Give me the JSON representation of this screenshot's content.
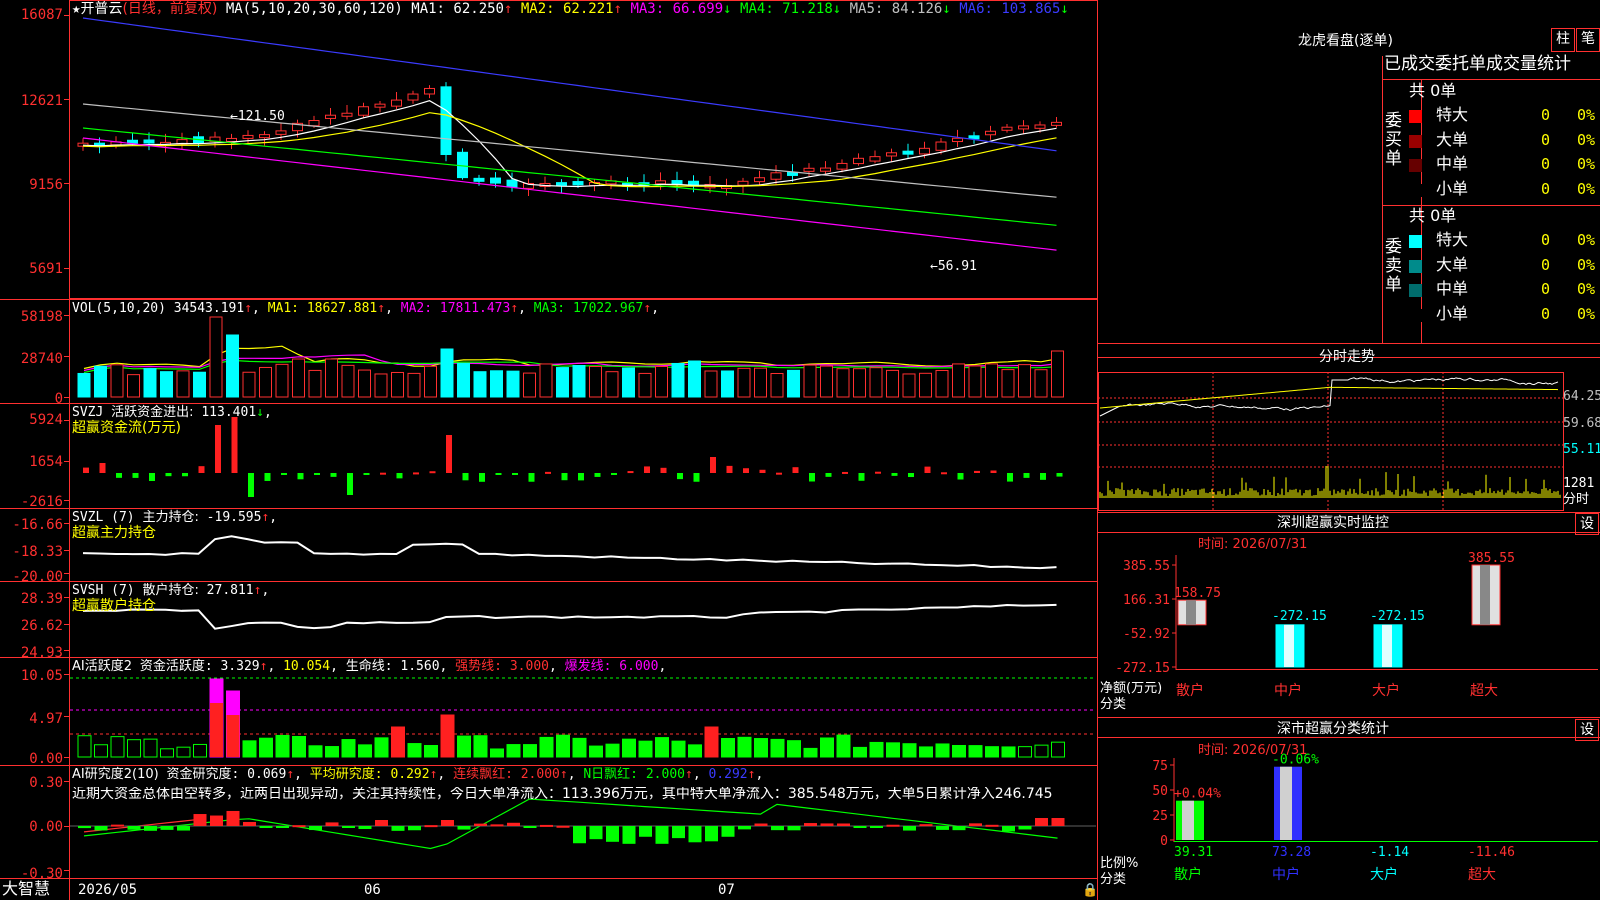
{
  "app": {
    "brand": "大智慧"
  },
  "main_chart": {
    "title_star": "★",
    "stock_name": "开普云",
    "mode": "(日线，前复权)",
    "ma_label": "MA(5,10,20,30,60,120)",
    "ma_values": [
      {
        "label": "MA1:",
        "value": "62.250",
        "arrow": "↑",
        "color": "#ffffff"
      },
      {
        "label": "MA2:",
        "value": "62.221",
        "arrow": "↑",
        "color": "#ffff00"
      },
      {
        "label": "MA3:",
        "value": "66.699",
        "arrow": "↓",
        "color": "#ff00ff"
      },
      {
        "label": "MA4:",
        "value": "71.218",
        "arrow": "↓",
        "color": "#00ff00"
      },
      {
        "label": "MA5:",
        "value": "84.126",
        "arrow": "↓",
        "color": "#c0c0c0"
      },
      {
        "label": "MA6:",
        "value": "103.865",
        "arrow": "↓",
        "color": "#3b3bff"
      }
    ],
    "y_ticks": [
      "16087",
      "12621",
      "9156",
      "5691"
    ],
    "annotation_high": "←121.50",
    "annotation_low": "←56.91"
  },
  "volume": {
    "label": "VOL(5,10,20)",
    "value": "34543.191",
    "arrow": "↑",
    "mas": [
      {
        "label": "MA1:",
        "value": "18627.881",
        "arrow": "↑",
        "color": "#ffff00"
      },
      {
        "label": "MA2:",
        "value": "17811.473",
        "arrow": "↑",
        "color": "#ff00ff"
      },
      {
        "label": "MA3:",
        "value": "17022.967",
        "arrow": "↑",
        "color": "#00ff00"
      }
    ],
    "y_ticks": [
      "58198",
      "28740",
      "0"
    ]
  },
  "svzj": {
    "label": "SVZJ",
    "desc": "活跃资金进出:",
    "value": "113.401",
    "arrow": "↓",
    "subtitle": "超赢资金流(万元)",
    "y_ticks": [
      "5924",
      "1654",
      "-2616"
    ]
  },
  "svzl": {
    "label": "SVZL (7)",
    "desc": "主力持仓:",
    "value": "-19.595",
    "arrow": "↑",
    "subtitle": "超赢主力持仓",
    "y_ticks": [
      "-16.66",
      "-18.33",
      "-20.00"
    ]
  },
  "svsh": {
    "label": "SVSH (7)",
    "desc": "散户持仓:",
    "value": "27.811",
    "arrow": "↑",
    "subtitle": "超赢散户持仓",
    "y_ticks": [
      "28.39",
      "26.62",
      "24.93"
    ]
  },
  "ai_active": {
    "label": "AI活跃度2",
    "items": [
      {
        "text": "资金活跃度: 3.329",
        "arrow": "↑",
        "color": "#ffffff"
      },
      {
        "text": "10.054",
        "color": "#ffff00"
      },
      {
        "text": "生命线: 1.560",
        "color": "#ffffff"
      },
      {
        "text": "强势线: 3.000",
        "color": "#ff3030"
      },
      {
        "text": "爆发线: 6.000",
        "color": "#ff00ff"
      }
    ],
    "y_ticks": [
      "10.05",
      "4.97",
      "0.00"
    ]
  },
  "ai_research": {
    "label": "AI研究度2(10)",
    "items": [
      {
        "text": "资金研究度: 0.069",
        "arrow": "↑",
        "color": "#ffffff"
      },
      {
        "text": "平均研究度: 0.292",
        "arrow": "↑",
        "color": "#ffff00"
      },
      {
        "text": "连续飘红: 2.000",
        "arrow": "↑",
        "color": "#ff3030"
      },
      {
        "text": "N日飘红: 2.000",
        "arrow": "↑",
        "color": "#00ff00"
      },
      {
        "text": "0.292",
        "arrow": "↑",
        "color": "#3b3bff"
      }
    ],
    "comment": "近期大资金总体由空转多，近两日出现异动，关注其持续性，今日大单净流入：113.396万元，其中特大单净流入：385.548万元，大单5日累计净入246.745",
    "y_ticks": [
      "0.30",
      "0.00",
      "-0.30"
    ]
  },
  "x_axis": {
    "labels": [
      "2026/05",
      "06",
      "07"
    ]
  },
  "dragon_tiger": {
    "title": "龙虎看盘(逐单)",
    "btn_bar": "柱",
    "btn_pen": "笔",
    "tabs": [
      "已成交",
      "委托单",
      "成交量",
      "统计"
    ],
    "buy": {
      "side_label": "委买单",
      "total": "共 0单",
      "rows": [
        {
          "name": "特大",
          "count": "0",
          "pct": "0%",
          "color": "#ff0000"
        },
        {
          "name": "大单",
          "count": "0",
          "pct": "0%",
          "color": "#990000"
        },
        {
          "name": "中单",
          "count": "0",
          "pct": "0%",
          "color": "#660000"
        },
        {
          "name": "小单",
          "count": "0",
          "pct": "0%",
          "color": "#000000"
        }
      ]
    },
    "sell": {
      "side_label": "委卖单",
      "total": "共 0单",
      "rows": [
        {
          "name": "特大",
          "count": "0",
          "pct": "0%",
          "color": "#00ffff"
        },
        {
          "name": "大单",
          "count": "0",
          "pct": "0%",
          "color": "#008b8b"
        },
        {
          "name": "中单",
          "count": "0",
          "pct": "0%",
          "color": "#006d6d"
        },
        {
          "name": "小单",
          "count": "0",
          "pct": "0%",
          "color": "#000000"
        }
      ]
    }
  },
  "intraday": {
    "title": "分时走势",
    "y_ticks": [
      "64.25",
      "59.68",
      "55.11"
    ],
    "vol_tick": "1281",
    "time_label": "分时"
  },
  "sz_monitor": {
    "title": "深圳超赢实时监控",
    "btn": "设",
    "time": "时间: 2026/07/31",
    "y_ticks": [
      "385.55",
      "166.31",
      "-52.92",
      "-272.15"
    ],
    "y_title": "净额(万元)",
    "x_title": "分类",
    "chart_data": {
      "type": "bar",
      "categories": [
        "散户",
        "中户",
        "大户",
        "超大"
      ],
      "values": [
        158.75,
        -272.15,
        -272.15,
        385.55
      ],
      "value_labels": [
        "158.75",
        "-272.15",
        "-272.15",
        "385.55"
      ],
      "ylim": [
        -272.15,
        385.55
      ],
      "ylabel": "净额(万元)",
      "xlabel": "分类"
    }
  },
  "sz_classify": {
    "title": "深市超赢分类统计",
    "btn": "设",
    "time": "时间: 2026/07/31",
    "y_ticks": [
      "75",
      "50",
      "25",
      "0"
    ],
    "y_title": "比例%",
    "x_title": "分类",
    "chart_data": {
      "type": "bar",
      "categories": [
        "散户",
        "中户",
        "大户",
        "超大"
      ],
      "values": [
        39.31,
        73.28,
        -1.14,
        -11.46
      ],
      "change_labels": [
        "+0.04%",
        "-0.06%",
        "",
        ""
      ],
      "value_labels": [
        "39.31",
        "73.28",
        "-1.14",
        "-11.46"
      ],
      "ylim": [
        0,
        75
      ],
      "ylabel": "比例%",
      "xlabel": "分类"
    }
  }
}
